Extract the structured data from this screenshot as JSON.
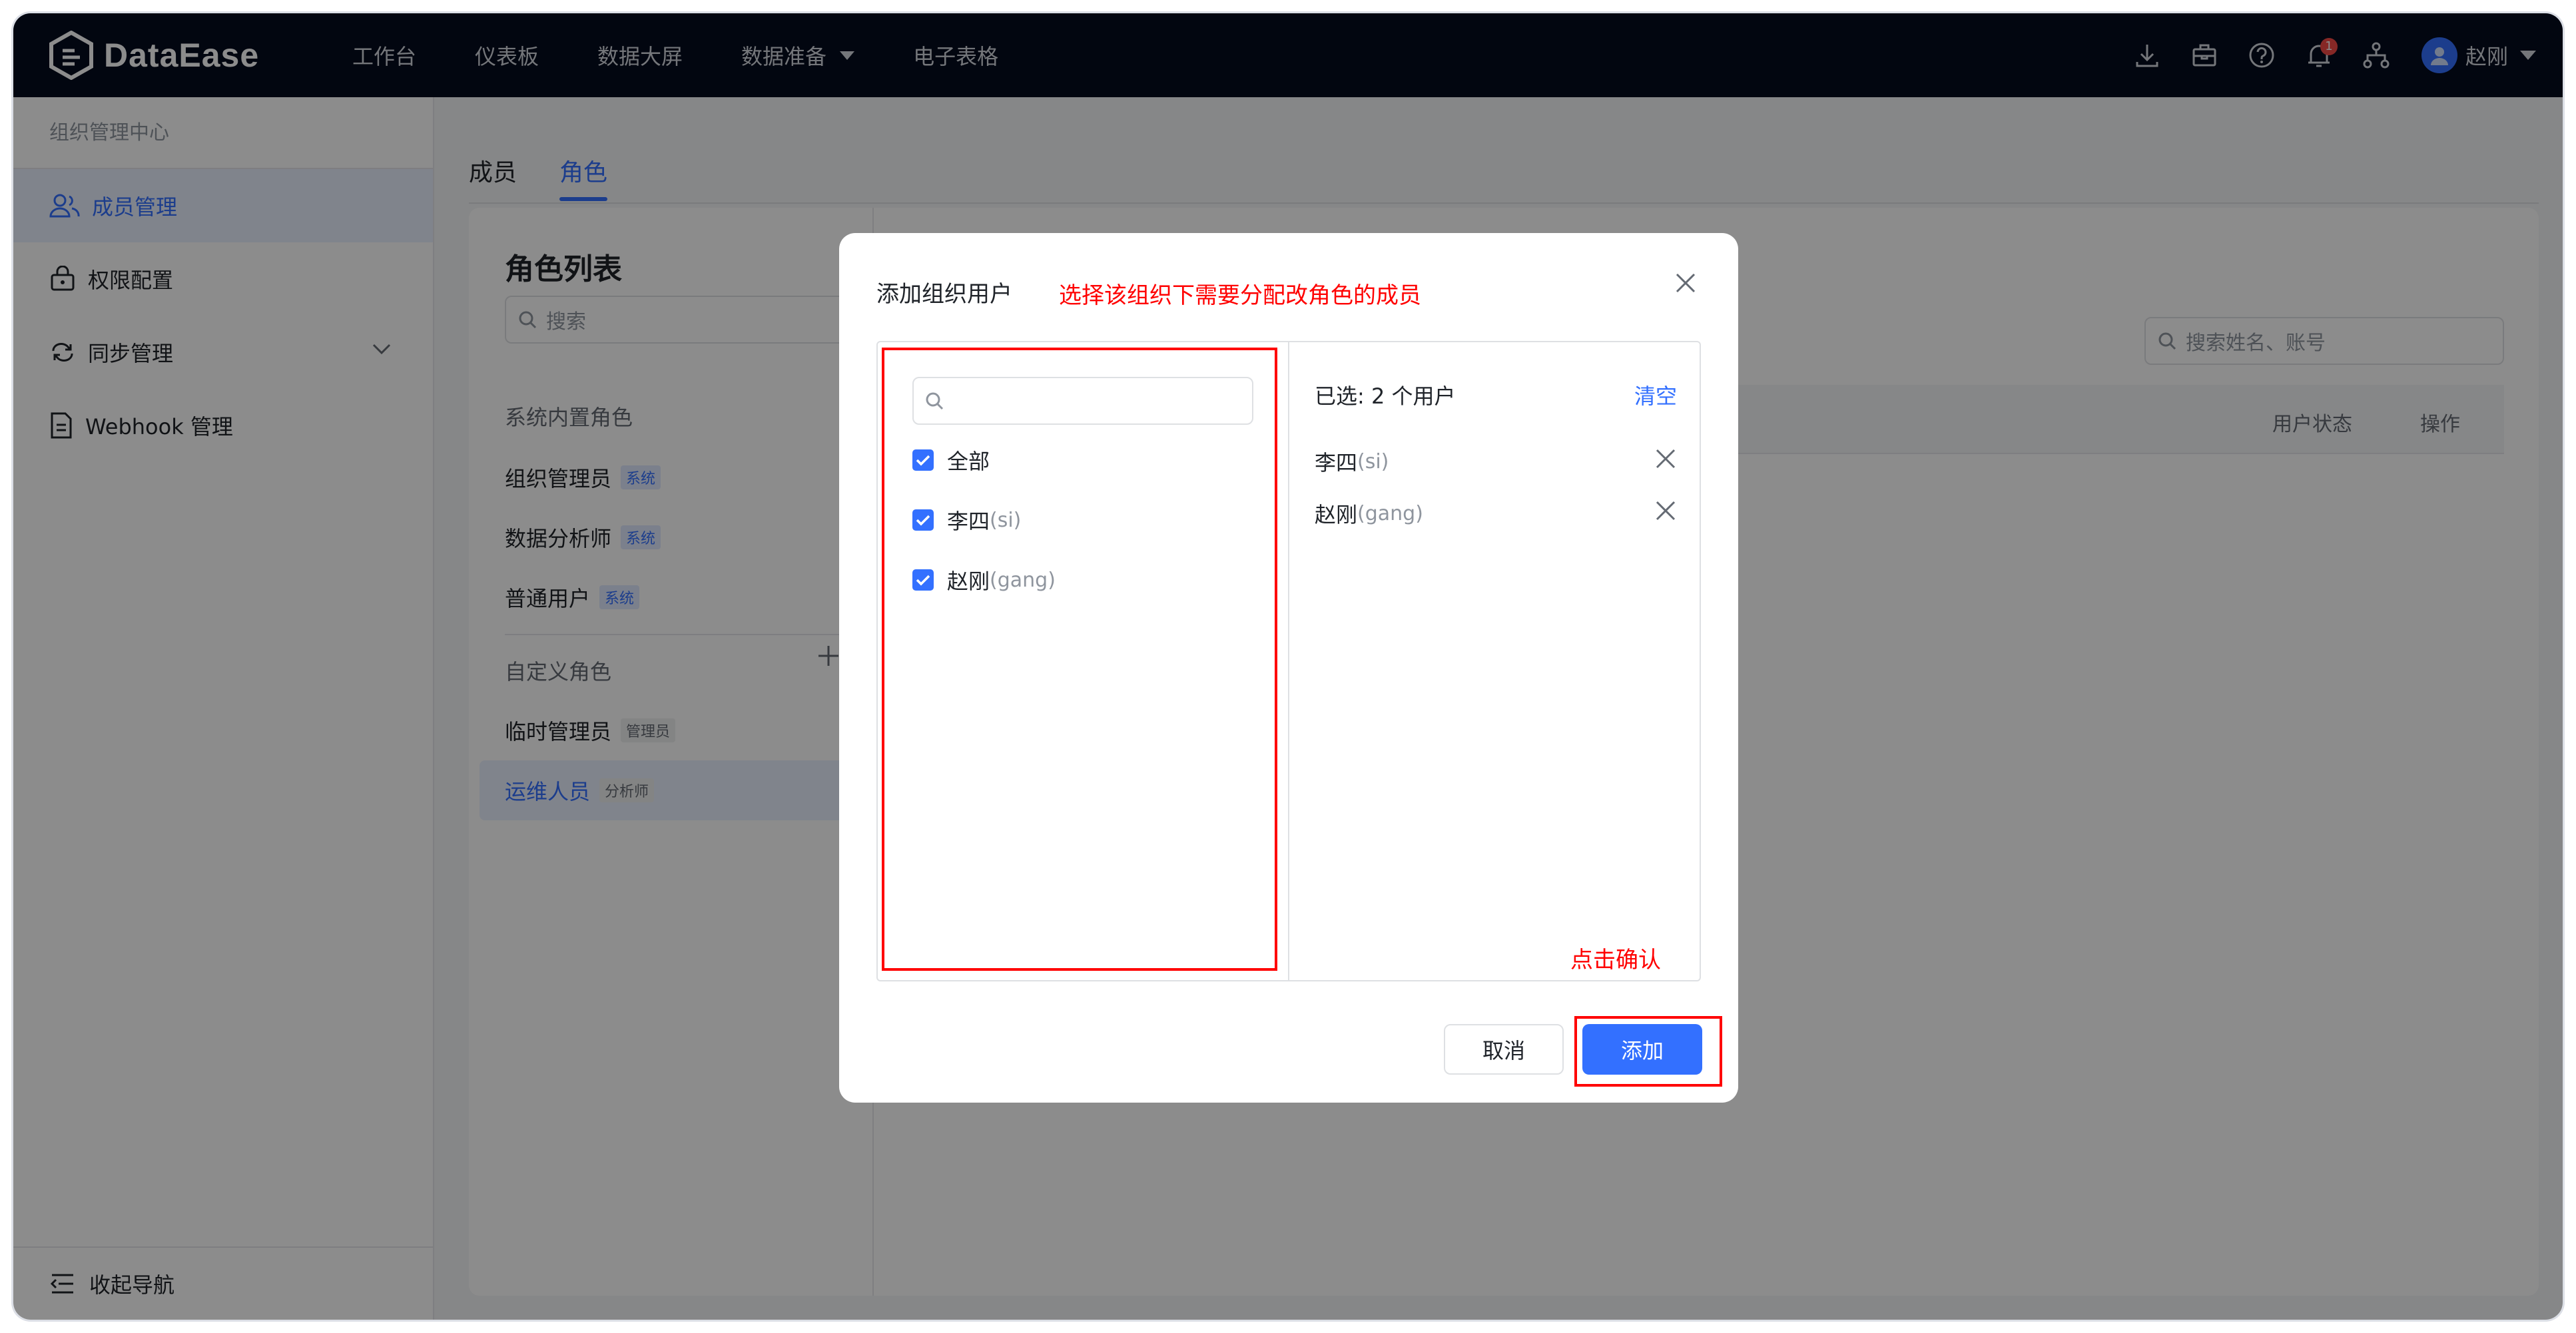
{
  "app": {
    "logo_text": "DataEase"
  },
  "nav": {
    "items": [
      "工作台",
      "仪表板",
      "数据大屏",
      "数据准备",
      "电子表格"
    ]
  },
  "header": {
    "notification_count": "1",
    "user_name": "赵刚"
  },
  "sidebar": {
    "title": "组织管理中心",
    "items": [
      {
        "label": "成员管理",
        "icon": "users-icon"
      },
      {
        "label": "权限配置",
        "icon": "lock-icon"
      },
      {
        "label": "同步管理",
        "icon": "sync-icon"
      },
      {
        "label": "Webhook 管理",
        "icon": "document-icon"
      }
    ],
    "collapse_label": "收起导航"
  },
  "tabs": {
    "member": "成员",
    "role": "角色"
  },
  "roles": {
    "title": "角色列表",
    "search_placeholder": "搜索",
    "builtin_label": "系统内置角色",
    "builtin": [
      {
        "name": "组织管理员",
        "tag": "系统"
      },
      {
        "name": "数据分析师",
        "tag": "系统"
      },
      {
        "name": "普通用户",
        "tag": "系统"
      }
    ],
    "custom_label": "自定义角色",
    "custom": [
      {
        "name": "临时管理员",
        "tag": "管理员"
      },
      {
        "name": "运维人员",
        "tag": "分析师"
      }
    ]
  },
  "user_table": {
    "search_placeholder": "搜索姓名、账号",
    "columns": [
      "用户状态",
      "操作"
    ]
  },
  "dialog": {
    "title": "添加组织用户",
    "annotation": "选择该组织下需要分配改角色的成员",
    "search_value": "",
    "options": [
      {
        "label": "全部",
        "account": "",
        "checked": true
      },
      {
        "label": "李四",
        "account": "(si)",
        "checked": true
      },
      {
        "label": "赵刚",
        "account": "(gang)",
        "checked": true
      }
    ],
    "selected_count": "已选: 2 个用户",
    "clear_label": "清空",
    "selected": [
      {
        "label": "李四",
        "account": "(si)"
      },
      {
        "label": "赵刚",
        "account": "(gang)"
      }
    ],
    "confirm_annotation": "点击确认",
    "cancel_label": "取消",
    "add_label": "添加"
  },
  "colors": {
    "accent": "#3370ff",
    "annotation": "#ff0000",
    "topbar": "#050c1e"
  }
}
